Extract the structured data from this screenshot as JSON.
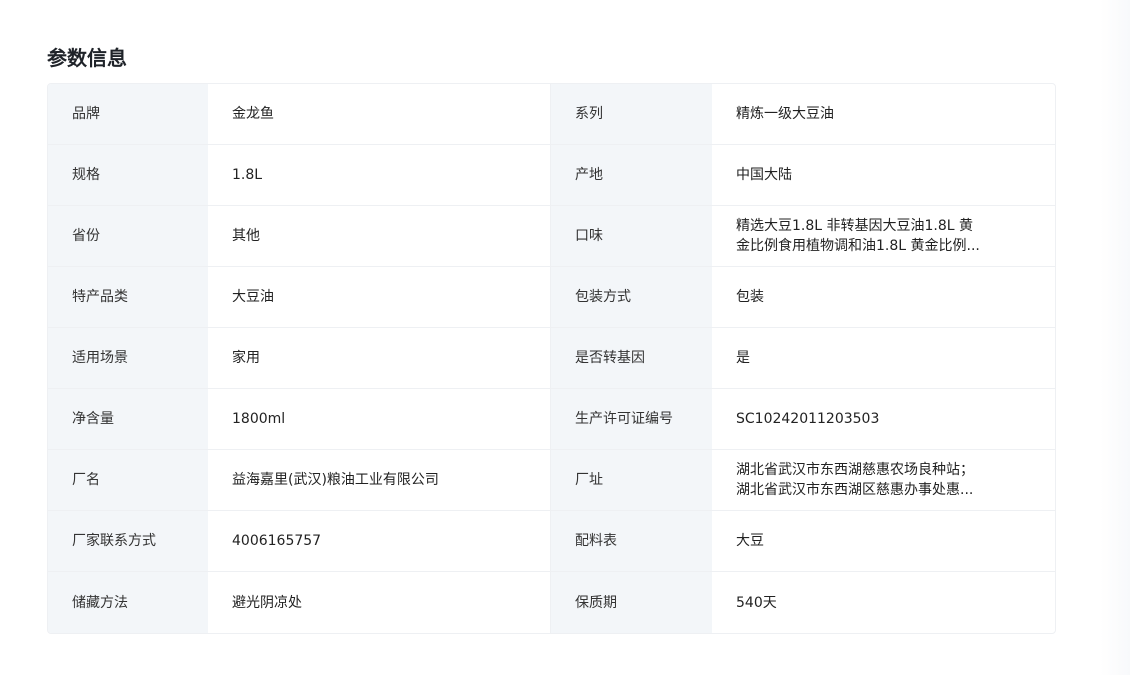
{
  "section": {
    "title": "参数信息"
  },
  "rows": [
    {
      "label1": "品牌",
      "value1": "金龙鱼",
      "label2": "系列",
      "value2": "精炼一级大豆油"
    },
    {
      "label1": "规格",
      "value1": "1.8L",
      "label2": "产地",
      "value2": "中国大陆"
    },
    {
      "label1": "省份",
      "value1": "其他",
      "label2": "口味",
      "value2": "精选大豆1.8L 非转基因大豆油1.8L 黄金比例食用植物调和油1.8L 黄金比例..."
    },
    {
      "label1": "特产品类",
      "value1": "大豆油",
      "label2": "包装方式",
      "value2": "包装"
    },
    {
      "label1": "适用场景",
      "value1": "家用",
      "label2": "是否转基因",
      "value2": "是"
    },
    {
      "label1": "净含量",
      "value1": "1800ml",
      "label2": "生产许可证编号",
      "value2": "SC10242011203503"
    },
    {
      "label1": "厂名",
      "value1": "益海嘉里(武汉)粮油工业有限公司",
      "label2": "厂址",
      "value2": "湖北省武汉市东西湖慈惠农场良种站；湖北省武汉市东西湖区慈惠办事处惠..."
    },
    {
      "label1": "厂家联系方式",
      "value1": "4006165757",
      "label2": "配料表",
      "value2": "大豆"
    },
    {
      "label1": "储藏方法",
      "value1": "避光阴凉处",
      "label2": "保质期",
      "value2": "540天"
    }
  ]
}
